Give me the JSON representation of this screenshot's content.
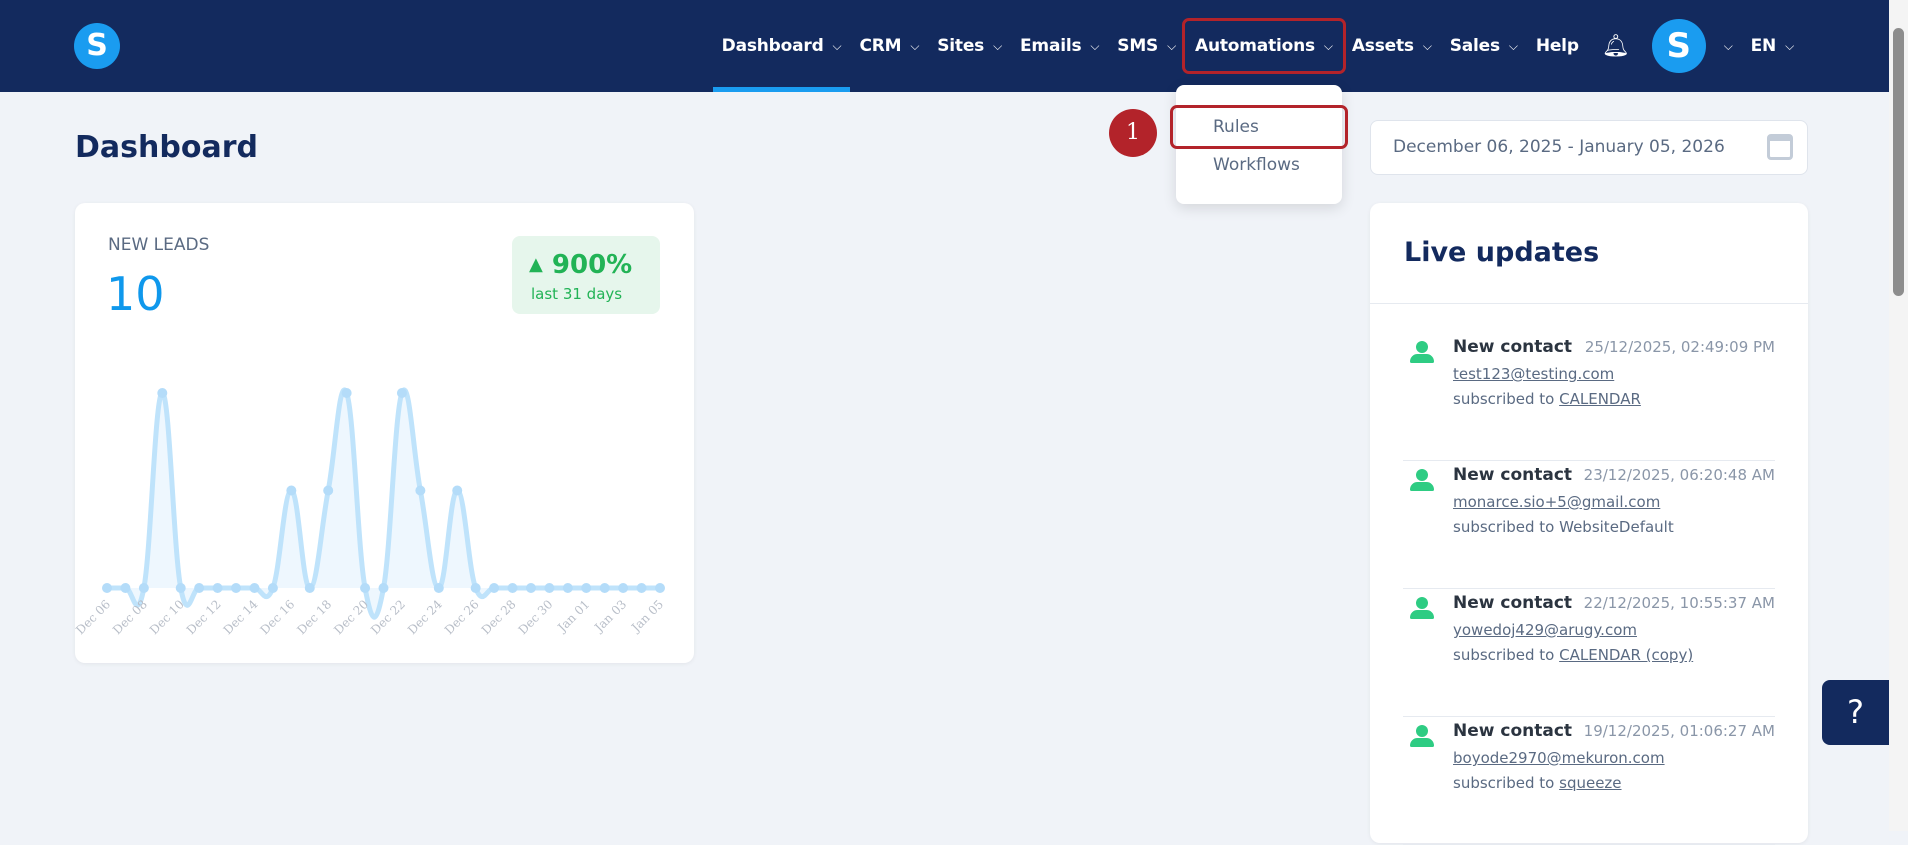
{
  "nav": {
    "logo": "S",
    "items": [
      {
        "label": "Dashboard",
        "active": true
      },
      {
        "label": "CRM"
      },
      {
        "label": "Sites"
      },
      {
        "label": "Emails"
      },
      {
        "label": "SMS"
      },
      {
        "label": "Automations",
        "highlighted": true
      },
      {
        "label": "Assets"
      },
      {
        "label": "Sales"
      }
    ],
    "help": "Help",
    "avatar": "S",
    "lang": "EN",
    "chevron": "⌵",
    "bell_icon": "bell-icon"
  },
  "dropdown": {
    "items": [
      "Rules",
      "Workflows"
    ],
    "step": "1"
  },
  "page": {
    "title": "Dashboard",
    "date_range": "December 06, 2025 - January 05, 2026"
  },
  "leads": {
    "label": "NEW LEADS",
    "value": "10",
    "change": "900%",
    "period": "last 31 days",
    "accent": "#0f98ec",
    "positive": "#22b356"
  },
  "chart_data": {
    "type": "area",
    "categories": [
      "Dec 06",
      "Dec 07",
      "Dec 08",
      "Dec 09",
      "Dec 10",
      "Dec 11",
      "Dec 12",
      "Dec 13",
      "Dec 14",
      "Dec 15",
      "Dec 16",
      "Dec 17",
      "Dec 18",
      "Dec 19",
      "Dec 20",
      "Dec 21",
      "Dec 22",
      "Dec 23",
      "Dec 24",
      "Dec 25",
      "Dec 26",
      "Dec 27",
      "Dec 28",
      "Dec 29",
      "Dec 30",
      "Dec 31",
      "Jan 01",
      "Jan 02",
      "Jan 03",
      "Jan 04",
      "Jan 05"
    ],
    "tick_labels": [
      "Dec 06",
      "Dec 08",
      "Dec 10",
      "Dec 12",
      "Dec 14",
      "Dec 16",
      "Dec 18",
      "Dec 20",
      "Dec 22",
      "Dec 24",
      "Dec 26",
      "Dec 28",
      "Dec 30",
      "Jan 01",
      "Jan 03",
      "Jan 05"
    ],
    "values": [
      0,
      0,
      0,
      2,
      0,
      0,
      0,
      0,
      0,
      0,
      1,
      0,
      1,
      2,
      0,
      0,
      2,
      1,
      0,
      1,
      0,
      0,
      0,
      0,
      0,
      0,
      0,
      0,
      0,
      0,
      0
    ],
    "ylim": [
      0,
      2.9
    ],
    "grid": false,
    "color": "#bfe3fb"
  },
  "live": {
    "title": "Live updates",
    "items": [
      {
        "title": "New contact",
        "date": "25/12/2025, 02:49:09 PM",
        "email": "test123@testing.com",
        "prefix": "subscribed to",
        "target": "CALENDAR",
        "link": true
      },
      {
        "title": "New contact",
        "date": "23/12/2025, 06:20:48 AM",
        "email": "monarce.sio+5@gmail.com",
        "prefix": "subscribed to",
        "target": "WebsiteDefault",
        "link": false
      },
      {
        "title": "New contact",
        "date": "22/12/2025, 10:55:37 AM",
        "email": "yowedoj429@arugy.com",
        "prefix": "subscribed to",
        "target": "CALENDAR (copy)",
        "link": true
      },
      {
        "title": "New contact",
        "date": "19/12/2025, 01:06:27 AM",
        "email": "boyode2970@mekuron.com",
        "prefix": "subscribed to",
        "target": "squeeze",
        "link": true
      }
    ]
  },
  "help_button": "?"
}
